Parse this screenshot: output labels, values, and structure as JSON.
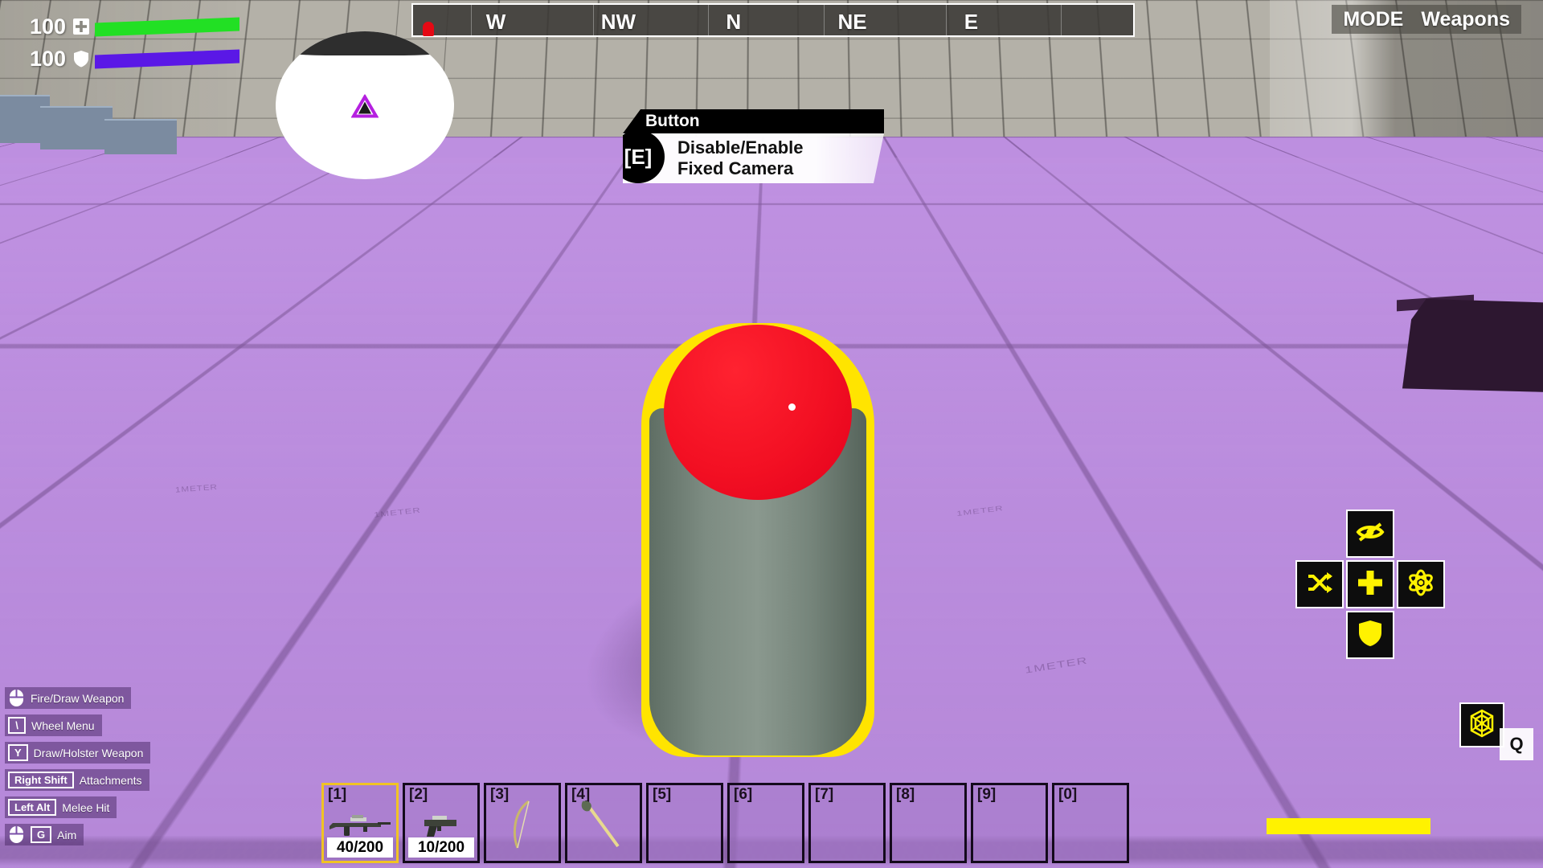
{
  "hud": {
    "vitals": [
      {
        "name": "health",
        "value": "100",
        "icon": "health-cross-icon",
        "color": "#22e024",
        "fill_pct": 100
      },
      {
        "name": "armor",
        "value": "100",
        "icon": "shield-icon",
        "color": "#5a18e6",
        "fill_pct": 100
      }
    ],
    "compass": {
      "marker_icon": "compass-marker-icon",
      "marker_color": "#e50914",
      "labels": [
        {
          "text": "W",
          "pos_pct": 11.5
        },
        {
          "text": "NW",
          "pos_pct": 28.5
        },
        {
          "text": "N",
          "pos_pct": 44.5
        },
        {
          "text": "NE",
          "pos_pct": 61.0
        },
        {
          "text": "E",
          "pos_pct": 77.5
        }
      ]
    },
    "minimap": {
      "player_marker_icon": "player-arrow-icon",
      "marker_color": "#b520e0"
    },
    "mode": {
      "key_label": "MODE",
      "value": "Weapons"
    },
    "prompt": {
      "title": "Button",
      "key": "[E]",
      "line1": "Disable/Enable",
      "line2": "Fixed Camera"
    },
    "keyhints": [
      {
        "key": "",
        "key_icon": "mouse-icon",
        "label": "Fire/Draw Weapon"
      },
      {
        "key": "\\",
        "key_icon": "",
        "label": "Wheel Menu"
      },
      {
        "key": "Y",
        "key_icon": "",
        "label": "Draw/Holster Weapon"
      },
      {
        "key": "Right Shift",
        "key_icon": "",
        "label": "Attachments"
      },
      {
        "key": "Left Alt",
        "key_icon": "",
        "label": "Melee Hit"
      },
      {
        "key": "G",
        "key_icon": "mouse-icon",
        "label": "Aim"
      }
    ],
    "hotbar": {
      "selected_index": 0,
      "selected_border_color": "#f0c324",
      "slots": [
        {
          "num": "[1]",
          "item_icon": "assault-rifle-icon",
          "ammo": "40/200",
          "selected": true
        },
        {
          "num": "[2]",
          "item_icon": "pistol-icon",
          "ammo": "10/200",
          "selected": false
        },
        {
          "num": "[3]",
          "item_icon": "bow-icon",
          "ammo": "",
          "selected": false
        },
        {
          "num": "[4]",
          "item_icon": "axe-icon",
          "ammo": "",
          "selected": false
        },
        {
          "num": "[5]",
          "item_icon": "",
          "ammo": "",
          "selected": false
        },
        {
          "num": "[6]",
          "item_icon": "",
          "ammo": "",
          "selected": false
        },
        {
          "num": "[7]",
          "item_icon": "",
          "ammo": "",
          "selected": false
        },
        {
          "num": "[8]",
          "item_icon": "",
          "ammo": "",
          "selected": false
        },
        {
          "num": "[9]",
          "item_icon": "",
          "ammo": "",
          "selected": false
        },
        {
          "num": "[0]",
          "item_icon": "",
          "ammo": "",
          "selected": false
        }
      ]
    },
    "abilities": {
      "accent_color": "#fff200",
      "items": [
        {
          "slot": "top",
          "icon": "eye-off-icon"
        },
        {
          "slot": "left",
          "icon": "shuffle-icon"
        },
        {
          "slot": "center",
          "icon": "plus-icon"
        },
        {
          "slot": "right",
          "icon": "atom-icon"
        },
        {
          "slot": "bottom",
          "icon": "shield-icon"
        }
      ],
      "extra": {
        "icon": "spider-web-icon",
        "badge": "Q"
      },
      "stamina": {
        "fill_pct": 100,
        "color": "#fff200"
      }
    }
  },
  "world": {
    "floor_color": "#bd8fe0",
    "wall_color": "#b4b1a8",
    "meter_labels": [
      "1METER",
      "1METER",
      "1METER",
      "1METER"
    ],
    "prop": {
      "name": "red-push-button",
      "dome_color": "#f31023",
      "body_color": "#7d8c82",
      "highlight_color": "#ffe400"
    }
  }
}
